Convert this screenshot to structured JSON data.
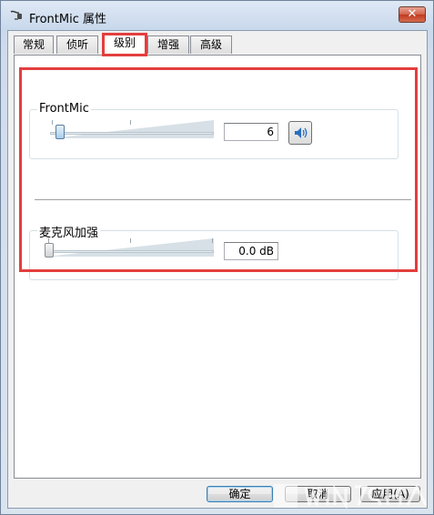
{
  "window": {
    "title": "FrontMic 属性",
    "close_symbol": "✕"
  },
  "tabs": [
    {
      "label": "常规",
      "active": false
    },
    {
      "label": "侦听",
      "active": false
    },
    {
      "label": "级别",
      "active": true
    },
    {
      "label": "增强",
      "active": false
    },
    {
      "label": "高级",
      "active": false
    }
  ],
  "levels": {
    "frontmic": {
      "label": "FrontMic",
      "value": "6",
      "level_fraction": 0.06,
      "mute_icon": "speaker-icon"
    },
    "boost": {
      "label": "麦克风加强",
      "value": "0.0 dB",
      "level_fraction": 0.0
    }
  },
  "buttons": {
    "ok": "确定",
    "cancel": "取消",
    "apply": "应用(A)"
  },
  "colors": {
    "highlight": "#e23e3e",
    "thumb": "#a9cdec"
  },
  "watermark": {
    "brand": "Win7系统之家"
  }
}
